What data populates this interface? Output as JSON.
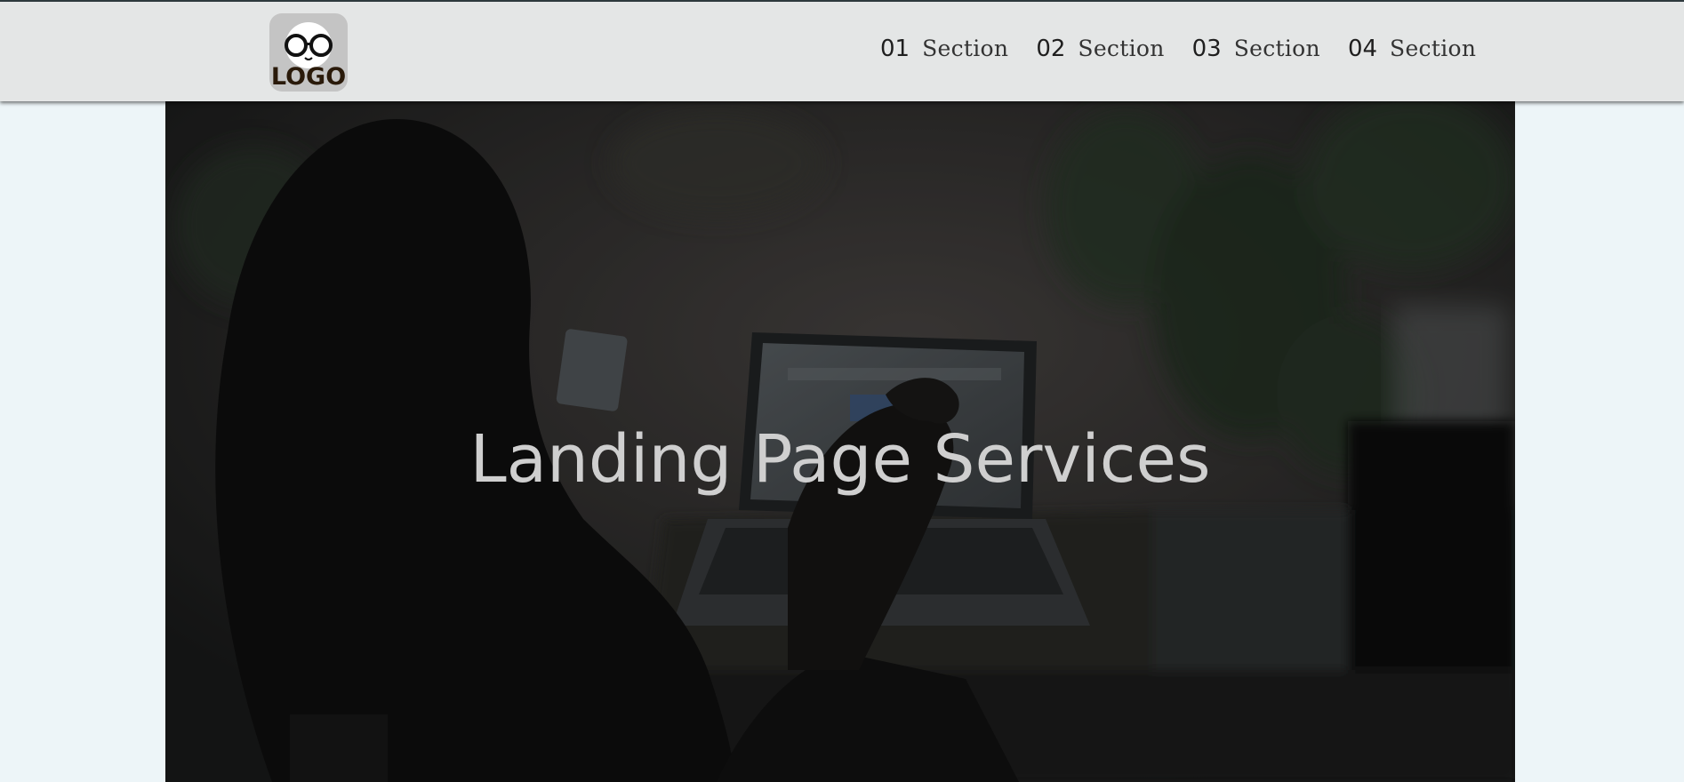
{
  "header": {
    "logo_text": "LOGO",
    "nav": [
      {
        "num": "01",
        "label": "Section"
      },
      {
        "num": "02",
        "label": "Section"
      },
      {
        "num": "03",
        "label": "Section"
      },
      {
        "num": "04",
        "label": "Section"
      }
    ]
  },
  "hero": {
    "title": "Landing Page Services"
  },
  "colors": {
    "page_bg": "#edf5f8",
    "navbar_bg": "#e4e6e6",
    "hero_text": "#cfcfcf"
  }
}
